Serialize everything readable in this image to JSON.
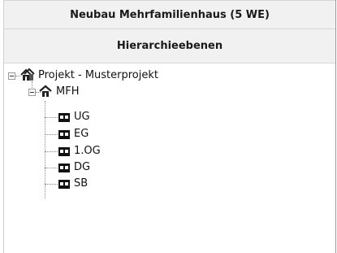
{
  "panel": {
    "title": "Neubau Mehrfamilienhaus (5 WE)",
    "subtitle": "Hierarchieebenen"
  },
  "tree": {
    "root": {
      "label": "Projekt - Musterprojekt",
      "icon": "building-group-icon",
      "expanded": true
    },
    "building": {
      "label": "MFH",
      "icon": "house-icon",
      "expanded": true
    },
    "floors": [
      {
        "label": "UG",
        "icon": "floor-icon"
      },
      {
        "label": "EG",
        "icon": "floor-icon"
      },
      {
        "label": "1.OG",
        "icon": "floor-icon"
      },
      {
        "label": "DG",
        "icon": "floor-icon"
      },
      {
        "label": "SB",
        "icon": "floor-icon"
      }
    ]
  }
}
